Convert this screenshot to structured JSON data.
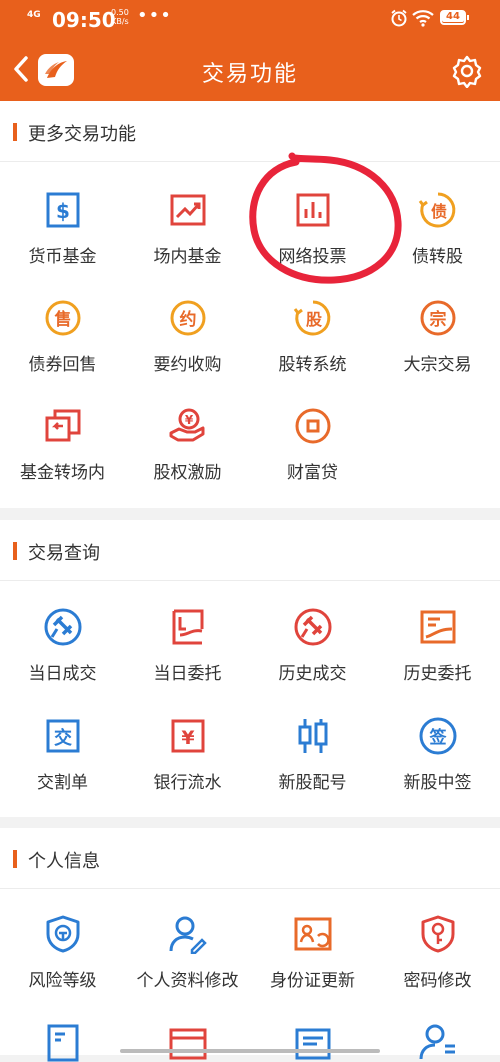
{
  "status": {
    "network": "4G",
    "time": "09:50",
    "speed_value": "0.50",
    "speed_unit": "KB/s",
    "dots": "•••",
    "battery": "44"
  },
  "nav": {
    "title": "交易功能"
  },
  "sections": [
    {
      "title": "更多交易功能",
      "items": [
        {
          "label": "货币基金",
          "icon": "dollar-icon",
          "color": "#2b7cd3"
        },
        {
          "label": "场内基金",
          "icon": "trend-chart-icon",
          "color": "#e0443c"
        },
        {
          "label": "网络投票",
          "icon": "bar-chart-icon",
          "color": "#e0443c"
        },
        {
          "label": "债转股",
          "icon": "bond-icon",
          "color": "#f0a020"
        },
        {
          "label": "债券回售",
          "icon": "sell-icon",
          "color": "#f0a020"
        },
        {
          "label": "要约收购",
          "icon": "contract-icon",
          "color": "#e86a2a"
        },
        {
          "label": "股转系统",
          "icon": "share-transfer-icon",
          "color": "#f0a020"
        },
        {
          "label": "大宗交易",
          "icon": "bulk-trade-icon",
          "color": "#e86a2a"
        },
        {
          "label": "基金转场内",
          "icon": "transfer-icon",
          "color": "#e0443c"
        },
        {
          "label": "股权激励",
          "icon": "incentive-icon",
          "color": "#e0443c"
        },
        {
          "label": "财富贷",
          "icon": "coin-icon",
          "color": "#e86a2a"
        }
      ]
    },
    {
      "title": "交易查询",
      "items": [
        {
          "label": "当日成交",
          "icon": "gavel-icon",
          "color": "#2b7cd3"
        },
        {
          "label": "当日委托",
          "icon": "entrust-icon",
          "color": "#e0443c"
        },
        {
          "label": "历史成交",
          "icon": "history-deal-icon",
          "color": "#e0443c"
        },
        {
          "label": "历史委托",
          "icon": "history-entrust-icon",
          "color": "#e86a2a"
        },
        {
          "label": "交割单",
          "icon": "delivery-icon",
          "color": "#2b7cd3"
        },
        {
          "label": "银行流水",
          "icon": "yen-icon",
          "color": "#e0443c"
        },
        {
          "label": "新股配号",
          "icon": "candlestick-icon",
          "color": "#2b7cd3"
        },
        {
          "label": "新股中签",
          "icon": "sign-icon",
          "color": "#2b7cd3"
        }
      ]
    },
    {
      "title": "个人信息",
      "items": [
        {
          "label": "风险等级",
          "icon": "shield-icon",
          "color": "#2b7cd3"
        },
        {
          "label": "个人资料修改",
          "icon": "user-edit-icon",
          "color": "#2b7cd3"
        },
        {
          "label": "身份证更新",
          "icon": "id-card-icon",
          "color": "#e86a2a"
        },
        {
          "label": "密码修改",
          "icon": "key-icon",
          "color": "#e0443c"
        },
        {
          "label": "",
          "icon": "document-icon",
          "color": "#2b7cd3"
        },
        {
          "label": "",
          "icon": "card-icon",
          "color": "#e0443c"
        },
        {
          "label": "",
          "icon": "form-icon",
          "color": "#2b7cd3"
        },
        {
          "label": "",
          "icon": "user-list-icon",
          "color": "#2b7cd3"
        }
      ]
    }
  ]
}
